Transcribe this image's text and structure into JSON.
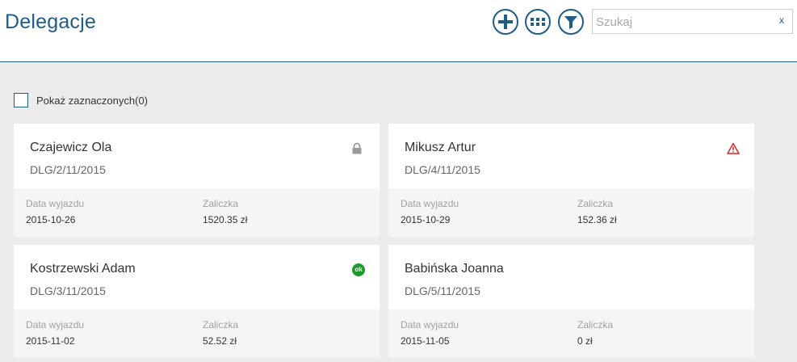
{
  "header": {
    "title": "Delegacje",
    "accent_color": "#1f5c86",
    "buttons": [
      {
        "icon": "plus-icon"
      },
      {
        "icon": "grid-icon"
      },
      {
        "icon": "filter-icon"
      }
    ],
    "search": {
      "placeholder": "Szukaj",
      "value": "",
      "clear_label": "x"
    }
  },
  "show_selected": {
    "label": "Pokaż zaznaczonych(0)",
    "checked": false
  },
  "cards": [
    {
      "name": "Czajewicz Ola",
      "number": "DLG/2/11/2015",
      "status_icon": "lock-icon",
      "departure_label": "Data wyjazdu",
      "departure_date": "2015-10-26",
      "advance_label": "Zaliczka",
      "advance_value": "1520.35 zł"
    },
    {
      "name": "Mikusz Artur",
      "number": "DLG/4/11/2015",
      "status_icon": "warning-icon",
      "departure_label": "Data wyjazdu",
      "departure_date": "2015-10-29",
      "advance_label": "Zaliczka",
      "advance_value": "152.36 zł"
    },
    {
      "name": "Kostrzewski Adam",
      "number": "DLG/3/11/2015",
      "status_icon": "ok-badge-icon",
      "status_text": "ok",
      "departure_label": "Data wyjazdu",
      "departure_date": "2015-11-02",
      "advance_label": "Zaliczka",
      "advance_value": "52.52 zł"
    },
    {
      "name": "Babińska Joanna",
      "number": "DLG/5/11/2015",
      "status_icon": "",
      "departure_label": "Data wyjazdu",
      "departure_date": "2015-11-05",
      "advance_label": "Zaliczka",
      "advance_value": "0 zł"
    }
  ]
}
